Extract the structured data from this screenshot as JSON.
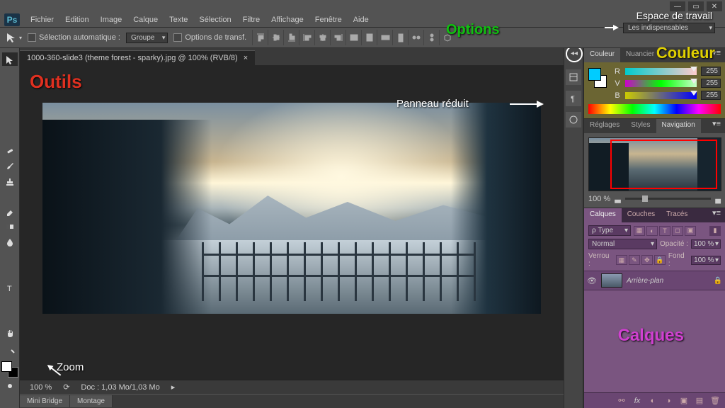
{
  "window": {
    "min": "—",
    "max": "▭",
    "close": "✕"
  },
  "menu": [
    "Fichier",
    "Edition",
    "Image",
    "Calque",
    "Texte",
    "Sélection",
    "Filtre",
    "Affichage",
    "Fenêtre",
    "Aide"
  ],
  "options": {
    "auto_select": "Sélection automatique :",
    "group": "Groupe",
    "transform": "Options de transf."
  },
  "workspace": {
    "label": "Espace de travail",
    "preset": "Les indispensables"
  },
  "document": {
    "tab": "1000-360-slide3 (theme forest - sparky).jpg @ 100% (RVB/8)",
    "close": "×",
    "zoom": "100 %",
    "docinfo": "Doc : 1,03 Mo/1,03 Mo"
  },
  "bottom_tabs": [
    "Mini Bridge",
    "Montage"
  ],
  "color_panel": {
    "tabs": [
      "Couleur",
      "Nuancier"
    ],
    "channels": [
      {
        "lbl": "R",
        "val": "255",
        "cls": "r"
      },
      {
        "lbl": "V",
        "val": "255",
        "cls": "v"
      },
      {
        "lbl": "B",
        "val": "255",
        "cls": "b"
      }
    ]
  },
  "nav_panel": {
    "tabs": [
      "Réglages",
      "Styles",
      "Navigation"
    ],
    "zoom": "100 %"
  },
  "layers_panel": {
    "tabs": [
      "Calques",
      "Couches",
      "Tracés"
    ],
    "kind": "ρ Type",
    "blend": "Normal",
    "opacity_lbl": "Opacité :",
    "opacity": "100 %",
    "lock_lbl": "Verrou :",
    "fill_lbl": "Fond :",
    "fill": "100 %",
    "layer": "Arrière-plan"
  },
  "annotations": {
    "outils": "Outils",
    "options": "Options",
    "couleur": "Couleur",
    "calques": "Calques",
    "panneau": "Panneau réduit",
    "zoom": "Zoom"
  }
}
